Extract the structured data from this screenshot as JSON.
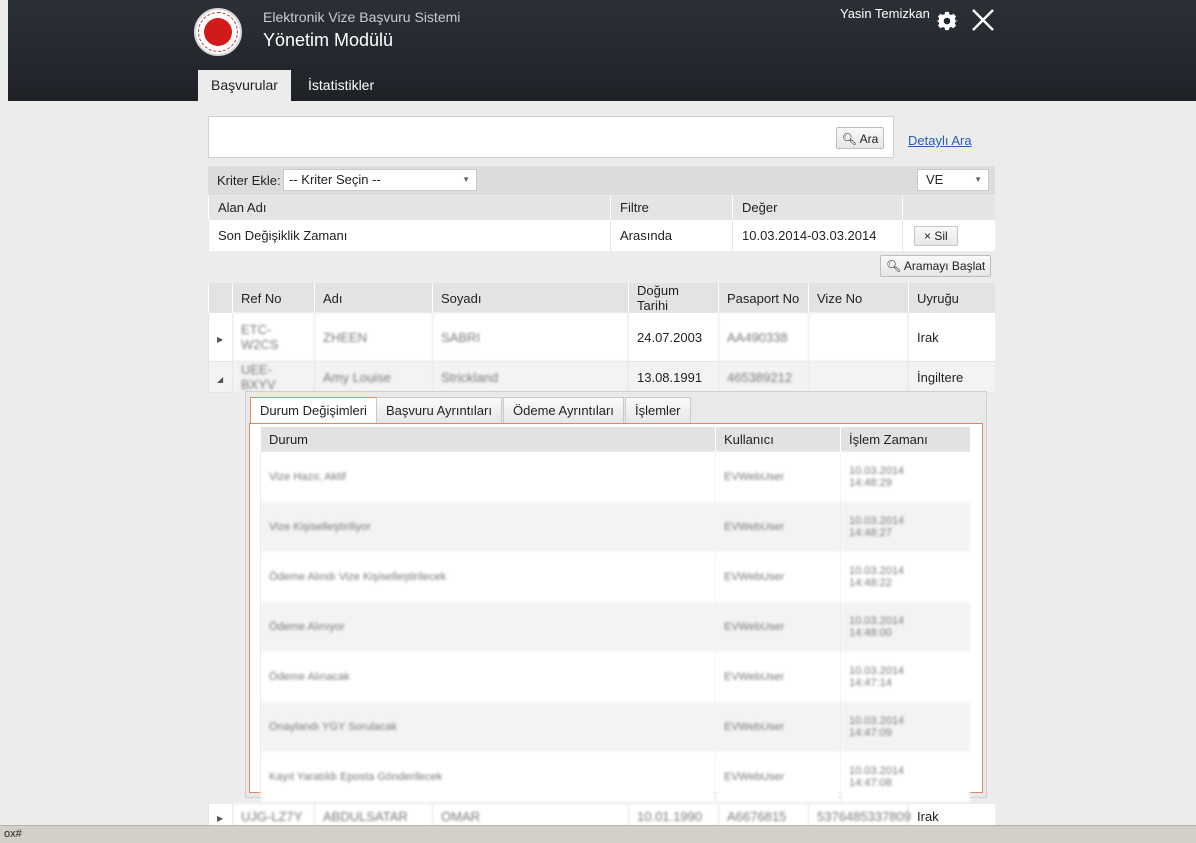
{
  "header": {
    "subtitle": "Elektronik Vize Başvuru Sistemi",
    "title": "Yönetim Modülü",
    "user_name": "Yasin Temizkan",
    "gear_icon": "gear-icon",
    "close_icon": "close-icon"
  },
  "tabs": [
    {
      "label": "Başvurular",
      "active": true
    },
    {
      "label": "İstatistikler",
      "active": false
    }
  ],
  "search": {
    "value": "",
    "button_label": "Ara",
    "advanced_link": "Detaylı Ara"
  },
  "criteria": {
    "label": "Kriter Ekle:",
    "select_value": "-- Kriter Seçin --",
    "logic_value": "VE",
    "headers": [
      "Alan Adı",
      "Filtre",
      "Değer"
    ],
    "rows": [
      {
        "field": "Son Değişiklik Zamanı",
        "filter": "Arasında",
        "value": "10.03.2014-03.03.2014",
        "remove_label": "× Sil"
      }
    ],
    "start_button": "Aramayı Başlat"
  },
  "results": {
    "headers": [
      "Ref No",
      "Adı",
      "Soyadı",
      "Doğum Tarihi",
      "Pasaport No",
      "Vize No",
      "Uyruğu"
    ],
    "rows": [
      {
        "ref": "ETC-W2CS",
        "name": "ZHEEN",
        "surname": "SABRI",
        "birth": "24.07.2003",
        "passport": "AA490338",
        "visa": "",
        "nationality": "Irak",
        "expanded": false
      },
      {
        "ref": "UEE-BXYV",
        "name": "Amy Louise",
        "surname": "Strickland",
        "birth": "13.08.1991",
        "passport": "465389212",
        "visa": "",
        "nationality": "İngiltere",
        "expanded": true
      }
    ],
    "last_row": {
      "ref": "UJG-LZ7Y",
      "name": "ABDULSATAR",
      "surname": "OMAR",
      "birth": "10.01.1990",
      "passport": "A6676815",
      "visa": "5376485337809",
      "nationality": "Irak"
    }
  },
  "detail": {
    "tabs": [
      "Durum Değişimleri",
      "Başvuru Ayrıntıları",
      "Ödeme Ayrıntıları",
      "İşlemler"
    ],
    "headers": [
      "Durum",
      "Kullanıcı",
      "İşlem Zamanı"
    ],
    "rows": [
      {
        "status": "Vize Hazır, Aktif",
        "user": "EVWebUser",
        "date": "10.03.2014",
        "time": "14:48:29"
      },
      {
        "status": "Vize Kişiselleştiriliyor",
        "user": "EVWebUser",
        "date": "10.03.2014",
        "time": "14:48:27"
      },
      {
        "status": "Ödeme Alındı Vize Kişiselleştirilecek",
        "user": "EVWebUser",
        "date": "10.03.2014",
        "time": "14:48:22"
      },
      {
        "status": "Ödeme Alınıyor",
        "user": "EVWebUser",
        "date": "10.03.2014",
        "time": "14:48:00"
      },
      {
        "status": "Ödeme Alınacak",
        "user": "EVWebUser",
        "date": "10.03.2014",
        "time": "14:47:14"
      },
      {
        "status": "Onaylandı YGY Sorulacak",
        "user": "EVWebUser",
        "date": "10.03.2014",
        "time": "14:47:09"
      },
      {
        "status": "Kayıt Yaratıldı Eposta Gönderilecek",
        "user": "EVWebUser",
        "date": "10.03.2014",
        "time": "14:47:08"
      }
    ]
  },
  "statusbar": {
    "text": "ox#"
  }
}
